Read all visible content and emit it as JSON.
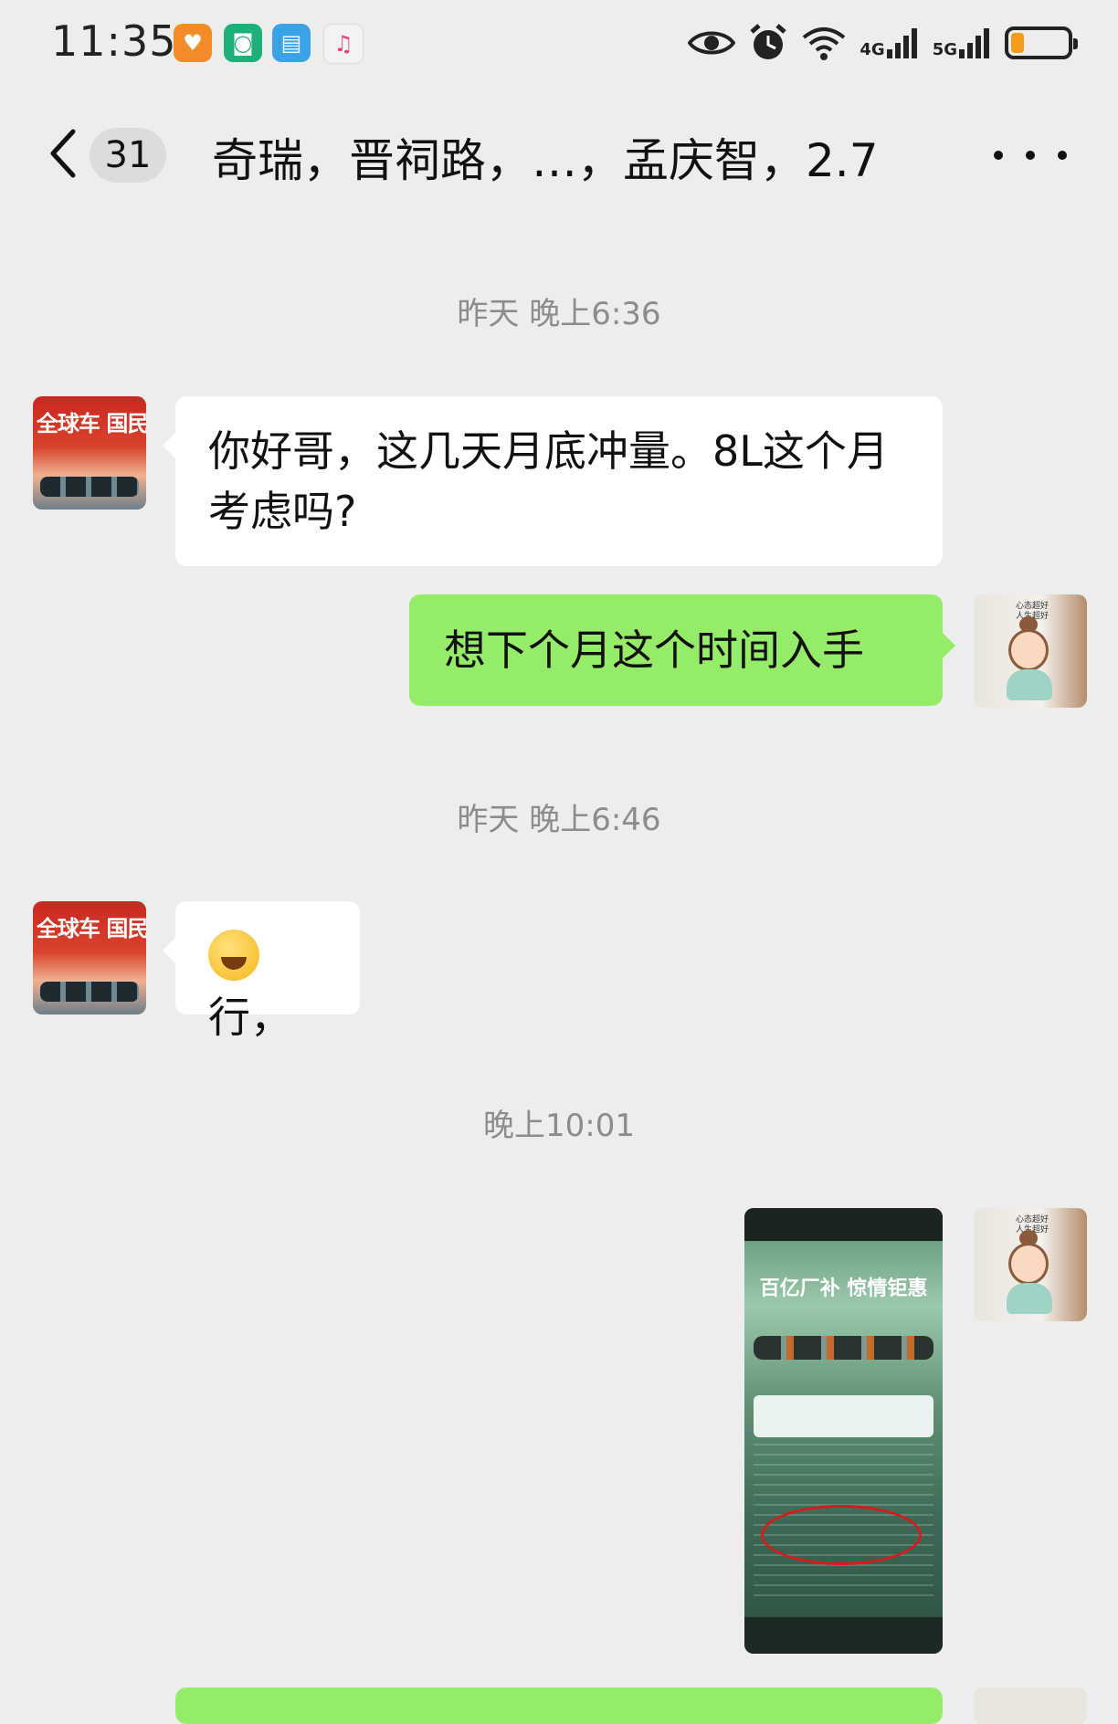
{
  "status_bar": {
    "time": "11:35",
    "net_4g": "4G",
    "net_5g": "5G"
  },
  "header": {
    "unread_count": "31",
    "title": "奇瑞，晋祠路，…，孟庆智，2.7"
  },
  "messages": [
    {
      "type": "time",
      "text": "昨天 晚上6:36"
    },
    {
      "type": "text",
      "side": "left",
      "avatar": "car-dealer-avatar",
      "text": "你好哥，这几天月底冲量。8L这个月考虑吗?"
    },
    {
      "type": "text",
      "side": "right",
      "avatar": "user-avatar",
      "text": "想下个月这个时间入手"
    },
    {
      "type": "time",
      "text": "昨天 晚上6:46"
    },
    {
      "type": "emoji_text",
      "side": "left",
      "avatar": "car-dealer-avatar",
      "emoji": "crying-laughing-emoji",
      "text": "行，"
    },
    {
      "type": "time",
      "text": "晚上10:01"
    },
    {
      "type": "image",
      "side": "right",
      "avatar": "user-avatar",
      "content": "screenshot-of-car-promotion"
    }
  ],
  "colors": {
    "background": "#ededed",
    "incoming_bubble": "#ffffff",
    "outgoing_bubble": "#95ec69",
    "timestamp": "#8c8c8c"
  }
}
